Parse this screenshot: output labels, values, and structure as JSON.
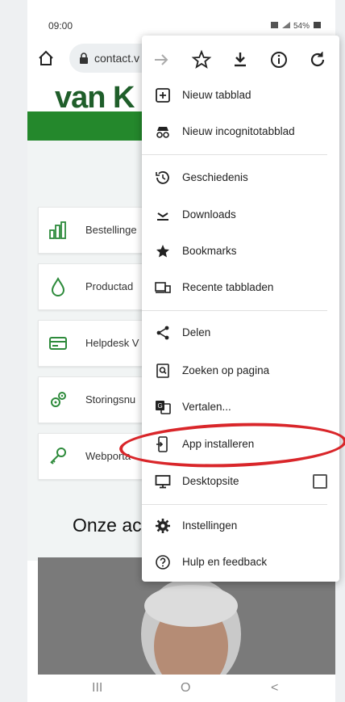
{
  "status_bar": {
    "time": "09:00",
    "right": "    54%"
  },
  "address_bar": {
    "url": "contact.v"
  },
  "site": {
    "logo": "van K",
    "cards": [
      {
        "label": "Bestellinge",
        "icon": "bar-chart-icon"
      },
      {
        "label": "Productad",
        "icon": "drop-icon"
      },
      {
        "label": "Helpdesk V",
        "icon": "card-icon"
      },
      {
        "label": "Storingsnu",
        "icon": "gears-icon"
      },
      {
        "label": "Webporta",
        "icon": "key-icon"
      }
    ],
    "section_title": "Onze ac"
  },
  "nav": {
    "recent": "III",
    "home": "O",
    "back": "<"
  },
  "menu": {
    "toolbar": [
      "forward-icon",
      "star-icon",
      "download-icon",
      "info-icon",
      "refresh-icon"
    ],
    "items": [
      {
        "label": "Nieuw tabblad",
        "icon": "new-tab-icon"
      },
      {
        "label": "Nieuw incognitotabblad",
        "icon": "incognito-icon"
      },
      {
        "label": "Geschiedenis",
        "icon": "history-icon"
      },
      {
        "label": "Downloads",
        "icon": "downloads-icon"
      },
      {
        "label": "Bookmarks",
        "icon": "bookmark-star-icon"
      },
      {
        "label": "Recente tabbladen",
        "icon": "recent-tabs-icon"
      },
      {
        "label": "Delen",
        "icon": "share-icon"
      },
      {
        "label": "Zoeken op pagina",
        "icon": "find-in-page-icon"
      },
      {
        "label": "Vertalen...",
        "icon": "translate-icon"
      },
      {
        "label": "App installeren",
        "icon": "install-app-icon"
      },
      {
        "label": "Desktopsite",
        "icon": "desktop-icon"
      },
      {
        "label": "Instellingen",
        "icon": "settings-gear-icon"
      },
      {
        "label": "Hulp en feedback",
        "icon": "help-icon"
      }
    ]
  },
  "annotation_color": "#d9262a"
}
